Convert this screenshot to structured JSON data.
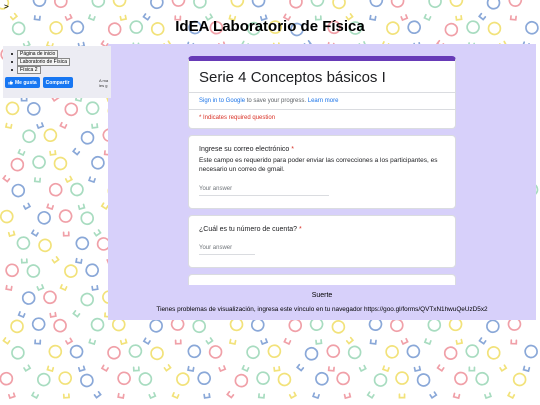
{
  "page": {
    "corner_glyph": ">",
    "title": "IdEA Laboratorio de Física"
  },
  "nav": {
    "items": [
      {
        "label": "Página de inicio"
      },
      {
        "label": "Laboratorio de Física"
      },
      {
        "label": "Física 2"
      }
    ],
    "like_button": "Me gusta",
    "share_button": "Compartir",
    "side_text_1": "A ma",
    "side_text_2": "les g"
  },
  "form": {
    "title": "Serie 4 Conceptos básicos I",
    "signin_link": "Sign in to Google",
    "signin_text": " to save your progress. ",
    "learn_more": "Learn more",
    "required_note": "* Indicates required question",
    "questions": [
      {
        "title": "Ingrese su correo electrónico",
        "required_mark": "*",
        "description": "Este campo es requerido para poder enviar las correcciones a los participantes, es necesario un correo de gmail.",
        "placeholder": "Your answer"
      },
      {
        "title": "¿Cuál es tu número de cuenta?",
        "required_mark": "*",
        "placeholder": "Your answer"
      }
    ]
  },
  "footer": {
    "suerte": "Suerte",
    "help_text": "Tienes problemas de visualización, ingresa este vínculo en tu navegador https://goo.gl/forms/QVTxN1hwuQeUzD5x2"
  },
  "colors": {
    "frame_bg": "#d7d0fa",
    "form_accent": "#673ab7",
    "required": "#d93025",
    "link": "#1a73e8",
    "facebook": "#1877f2",
    "bulb_yellow": "#f2e27a",
    "bulb_blue": "#8aa8d8",
    "bulb_pink": "#f0a0a8",
    "bulb_green": "#a8dcc0"
  }
}
